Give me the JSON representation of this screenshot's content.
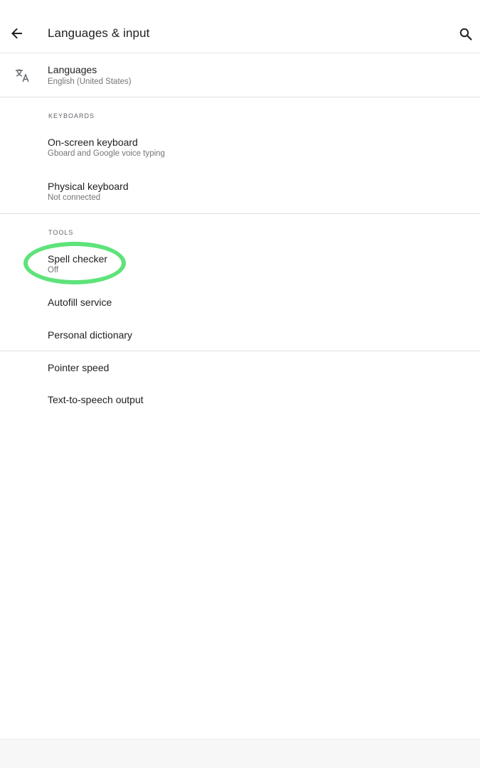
{
  "header": {
    "title": "Languages & input",
    "back_icon": "arrow-back-icon",
    "search_icon": "search-icon"
  },
  "languages": {
    "icon": "translate-icon",
    "title": "Languages",
    "summary": "English (United States)"
  },
  "keyboards": {
    "header": "KEYBOARDS",
    "items": [
      {
        "title": "On-screen keyboard",
        "summary": "Gboard and Google voice typing"
      },
      {
        "title": "Physical keyboard",
        "summary": "Not connected"
      }
    ]
  },
  "tools": {
    "header": "TOOLS",
    "spell_checker": {
      "title": "Spell checker",
      "summary": "Off"
    },
    "autofill": {
      "title": "Autofill service"
    },
    "dictionary": {
      "title": "Personal dictionary"
    }
  },
  "misc": {
    "pointer_speed": {
      "title": "Pointer speed"
    },
    "tts": {
      "title": "Text-to-speech output"
    }
  },
  "colors": {
    "highlight": "#5ee37a",
    "text_primary": "#202124",
    "text_secondary": "#757575",
    "divider": "#e0e0e0"
  }
}
